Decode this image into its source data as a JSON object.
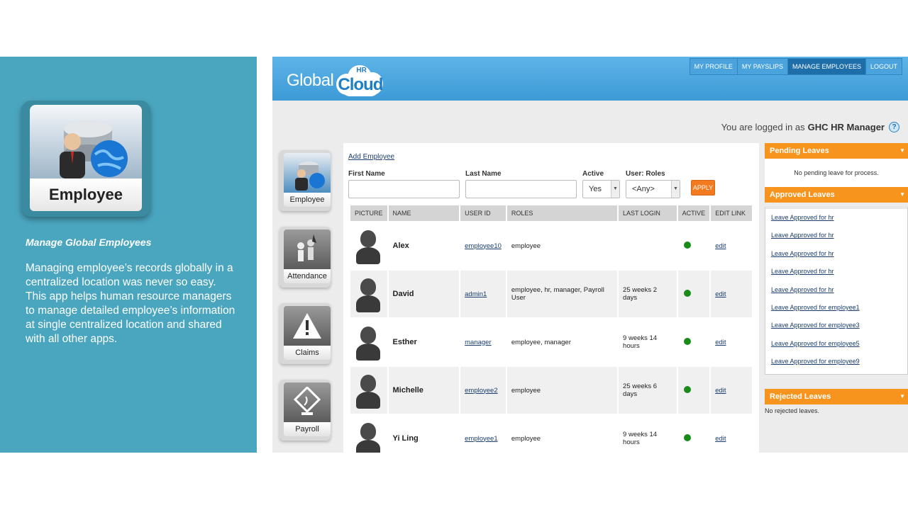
{
  "promo": {
    "icon_label": "Employee",
    "title": "Manage Global Employees",
    "description": "Managing employee’s records globally in a centralized location was never so easy. This app helps human resource managers to manage detailed employee’s information at single centralized location and shared with all other apps."
  },
  "header": {
    "logo_left": "Global",
    "logo_right": "Cloud",
    "logo_sup": "HR",
    "nav": [
      {
        "label": "MY PROFILE"
      },
      {
        "label": "MY PAYSLIPS"
      },
      {
        "label": "MANAGE EMPLOYEES"
      },
      {
        "label": "LOGOUT"
      }
    ],
    "logged_prefix": "You are logged in as",
    "logged_user": "GHC HR Manager",
    "help": "?"
  },
  "modules": [
    {
      "label": "Employee",
      "icon": "employee-icon"
    },
    {
      "label": "Attendance",
      "icon": "attendance-icon"
    },
    {
      "label": "Claims",
      "icon": "warning-icon"
    },
    {
      "label": "Payroll",
      "icon": "payroll-icon"
    }
  ],
  "main": {
    "add_employee": "Add Employee",
    "filters": {
      "first_name_label": "First Name",
      "last_name_label": "Last Name",
      "active_label": "Active",
      "active_value": "Yes",
      "roles_label": "User: Roles",
      "roles_value": "<Any>",
      "apply": "APPLY"
    },
    "columns": [
      "PICTURE",
      "NAME",
      "USER ID",
      "ROLES",
      "LAST LOGIN",
      "ACTIVE",
      "EDIT LINK"
    ],
    "rows": [
      {
        "name": "Alex",
        "user_id": "employee10",
        "roles": "employee",
        "last_login": "",
        "edit": "edit"
      },
      {
        "name": "David",
        "user_id": "admin1",
        "roles": "employee, hr, manager, Payroll User",
        "last_login": "25 weeks 2 days",
        "edit": "edit"
      },
      {
        "name": "Esther",
        "user_id": "manager",
        "roles": "employee, manager",
        "last_login": "9 weeks 14 hours",
        "edit": "edit"
      },
      {
        "name": "Michelle",
        "user_id": "employee2",
        "roles": "employee",
        "last_login": "25 weeks 6 days",
        "edit": "edit"
      },
      {
        "name": "Yi Ling",
        "user_id": "employee1",
        "roles": "employee",
        "last_login": "9 weeks 14 hours",
        "edit": "edit"
      }
    ]
  },
  "sidebar": {
    "pending_title": "Pending Leaves",
    "pending_text": "No pending leave for process.",
    "approved_title": "Approved Leaves",
    "approved_items": [
      "Leave Approved for hr",
      "Leave Approved for hr",
      "Leave Approved for hr",
      "Leave Approved for hr",
      "Leave Approved for hr",
      "Leave Approved for employee1",
      "Leave Approved for employee3",
      "Leave Approved for employee5",
      "Leave Approved for employee9"
    ],
    "rejected_title": "Rejected Leaves",
    "rejected_text": "No rejected leaves."
  },
  "colors": {
    "promo_bg": "#4aa5bf",
    "header_blue": "#3d9ad6",
    "accent_orange": "#f7941d",
    "active_green": "#1a8a1a"
  }
}
